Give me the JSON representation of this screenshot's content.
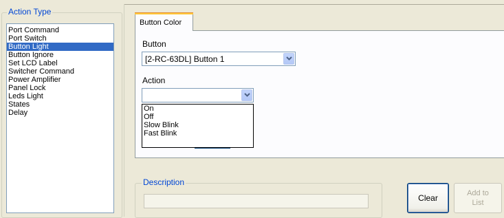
{
  "action_type": {
    "legend": "Action Type",
    "items": [
      {
        "label": "Port Command",
        "selected": false
      },
      {
        "label": "Port Switch",
        "selected": false
      },
      {
        "label": "Button Light",
        "selected": true
      },
      {
        "label": "Button Ignore",
        "selected": false
      },
      {
        "label": "Set LCD Label",
        "selected": false
      },
      {
        "label": "Switcher Command",
        "selected": false
      },
      {
        "label": "Power Amplifier",
        "selected": false
      },
      {
        "label": "Panel Lock",
        "selected": false
      },
      {
        "label": "Leds Light",
        "selected": false
      },
      {
        "label": "States",
        "selected": false
      },
      {
        "label": "Delay",
        "selected": false
      }
    ]
  },
  "tabs": [
    {
      "label": "Button Color",
      "active": true
    }
  ],
  "button_field": {
    "label": "Button",
    "value": "[2-RC-63DL] Button 1"
  },
  "action_field": {
    "label": "Action",
    "value": "",
    "options": [
      "On",
      "Off",
      "Slow Blink",
      "Fast Blink"
    ]
  },
  "description": {
    "legend": "Description",
    "value": ""
  },
  "buttons": {
    "clear": "Clear",
    "add_to_list_line1": "Add to",
    "add_to_list_line2": "List"
  },
  "colors": {
    "window_bg": "#ece9d8",
    "selection": "#316ac5",
    "group_legend": "#0046d5",
    "tab_accent": "#ffc83c"
  }
}
